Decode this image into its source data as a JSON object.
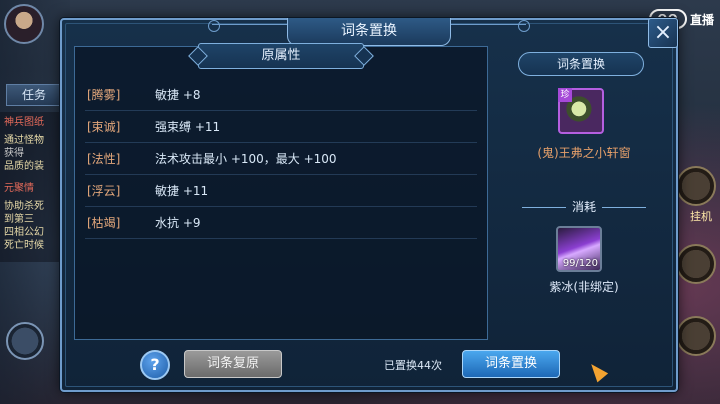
{
  "background": {
    "task_tab": "任务",
    "quests": [
      "神兵图纸",
      "通过怪物",
      "获得",
      "品质的装",
      "元聚情",
      "协助杀死",
      "到第三",
      "四相公幻",
      "死亡时候"
    ],
    "right_label": "挂机",
    "streamer_logo": "直播"
  },
  "dialog": {
    "title": "词条置换",
    "close_label": "×",
    "left_panel": {
      "header": "原属性",
      "attributes": [
        {
          "tag": "[腾雾]",
          "value": "敏捷 +8"
        },
        {
          "tag": "[束诚]",
          "value": "强束缚 +11"
        },
        {
          "tag": "[法性]",
          "value": "法术攻击最小 +100，最大 +100"
        },
        {
          "tag": "[浮云]",
          "value": "敏捷 +11"
        },
        {
          "tag": "[枯竭]",
          "value": "水抗 +9"
        }
      ]
    },
    "right_panel": {
      "header": "词条置换",
      "item_badge": "珍",
      "item_name": "(鬼)王弗之小轩窗",
      "consume_header": "消耗",
      "consume_count": "99/120",
      "consume_name": "紫冰(非绑定)"
    },
    "footer": {
      "help_label": "?",
      "restore_label": "词条复原",
      "replaced_text": "已置换44次",
      "replace_label": "词条置换"
    }
  },
  "colors": {
    "attr_tag": "#e3a77b",
    "item_name": "#e6a06a",
    "accent": "#4ba7ee"
  }
}
